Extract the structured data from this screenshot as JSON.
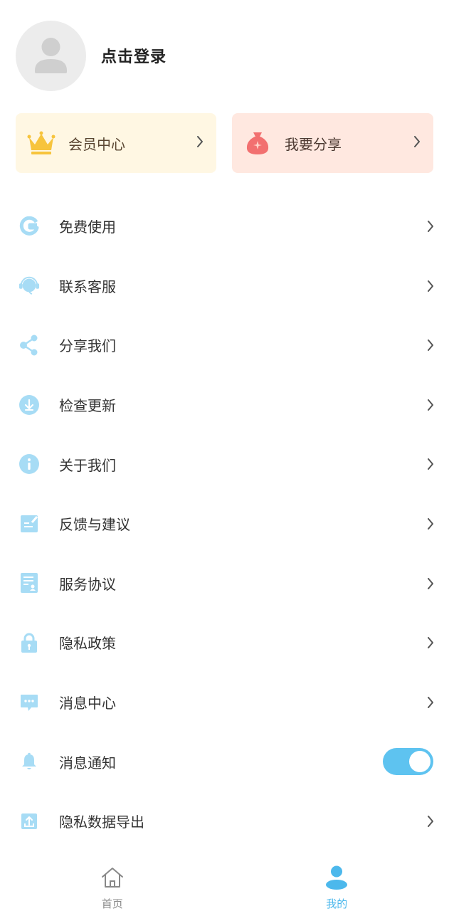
{
  "profile": {
    "login_text": "点击登录"
  },
  "cards": {
    "vip": {
      "label": "会员中心",
      "icon": "crown-icon"
    },
    "share": {
      "label": "我要分享",
      "icon": "money-bag-icon"
    }
  },
  "menu": [
    {
      "label": "免费使用",
      "icon": "g-letter-icon"
    },
    {
      "label": "联系客服",
      "icon": "headset-icon"
    },
    {
      "label": "分享我们",
      "icon": "share-icon"
    },
    {
      "label": "检查更新",
      "icon": "download-icon"
    },
    {
      "label": "关于我们",
      "icon": "info-icon"
    },
    {
      "label": "反馈与建议",
      "icon": "edit-icon"
    },
    {
      "label": "服务协议",
      "icon": "document-icon"
    },
    {
      "label": "隐私政策",
      "icon": "lock-icon"
    },
    {
      "label": "消息中心",
      "icon": "chat-icon"
    },
    {
      "label": "消息通知",
      "icon": "bell-icon",
      "toggle_on": true
    },
    {
      "label": "隐私数据导出",
      "icon": "upload-icon"
    }
  ],
  "tabbar": {
    "home": {
      "label": "首页",
      "icon": "home-icon"
    },
    "mine": {
      "label": "我的",
      "icon": "user-icon",
      "active": true
    }
  },
  "colors": {
    "accent": "#5ec3f0",
    "icon_light": "#a7dcf5",
    "vip_bg": "#fff7e3",
    "share_bg": "#ffe8e0",
    "share_icon": "#f27070",
    "crown": "#f7c43c"
  }
}
